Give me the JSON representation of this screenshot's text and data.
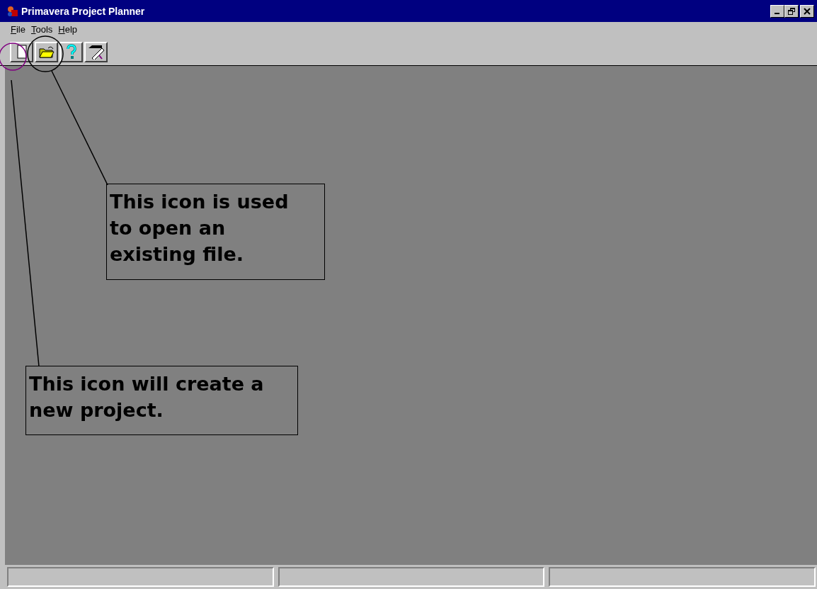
{
  "window": {
    "title": "Primavera Project Planner"
  },
  "menu": [
    {
      "label": "File"
    },
    {
      "label": "Tools"
    },
    {
      "label": "Help"
    }
  ],
  "callouts": [
    {
      "text": "This icon is used to open an existing file."
    },
    {
      "text": "This icon will create a new project."
    }
  ]
}
